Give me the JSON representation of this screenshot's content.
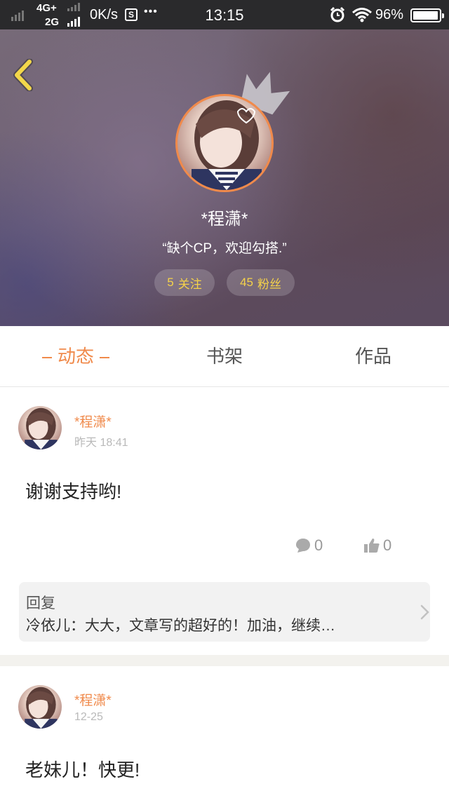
{
  "status_bar": {
    "network_top": "4G+",
    "network_bottom": "2G",
    "speed": "0K/s",
    "extra_icon": "S",
    "dots": "•••",
    "time": "13:15",
    "battery": "96%"
  },
  "header": {
    "nickname": "*程潇*",
    "signature": "“缺个CP，欢迎勾搭.”",
    "following_count": "5",
    "following_label": "关注",
    "followers_count": "45",
    "followers_label": "粉丝"
  },
  "tabs": [
    {
      "label": "动态",
      "active": true
    },
    {
      "label": "书架",
      "active": false
    },
    {
      "label": "作品",
      "active": false
    }
  ],
  "posts": [
    {
      "author": "*程潇*",
      "time": "昨天 18:41",
      "text": "谢谢支持哟!",
      "comment_count": "0",
      "like_count": "0",
      "reply": {
        "title": "回复",
        "text": "冷依儿：大大，文章写的超好的！加油，继续…"
      }
    },
    {
      "author": "*程潇*",
      "time": "12-25",
      "text": "老妹儿！快更!"
    }
  ],
  "colors": {
    "accent": "#f08a4b",
    "pill_text": "#f5d24a",
    "back_icon": "#f3d74a"
  }
}
